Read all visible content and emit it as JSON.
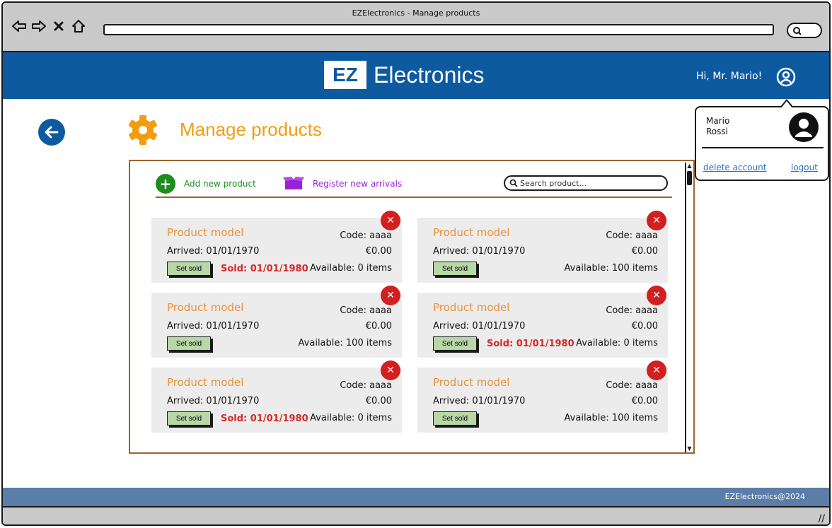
{
  "window": {
    "title": "EZElectronics - Manage products"
  },
  "browser": {
    "icons": [
      "back-arrow-icon",
      "forward-arrow-icon",
      "close-x-icon",
      "home-icon"
    ],
    "url": ""
  },
  "header": {
    "logo_box": "EZ",
    "logo_text": "Electronics",
    "greeting": "Hi, Mr. Mario!",
    "user_icon": "user-circle-icon",
    "color": "#0e5aa0"
  },
  "page": {
    "title": "Manage products",
    "title_color": "#f39c12",
    "icon": "gear-icon",
    "back_icon": "back-arrow-icon"
  },
  "toolbar": {
    "add_label": "Add new product",
    "register_label": "Register new arrivals",
    "search_placeholder": "Search product..."
  },
  "products": [
    {
      "model": "Product model",
      "code": "Code: aaaa",
      "arrived": "Arrived: 01/01/1970",
      "price": "€0.00",
      "set_sold": "Set sold",
      "sold": "Sold: 01/01/1980",
      "available": "Available: 0 items"
    },
    {
      "model": "Product model",
      "code": "Code: aaaa",
      "arrived": "Arrived: 01/01/1970",
      "price": "€0.00",
      "set_sold": "Set sold",
      "sold": "",
      "available": "Available: 100 items"
    },
    {
      "model": "Product model",
      "code": "Code: aaaa",
      "arrived": "Arrived: 01/01/1970",
      "price": "€0.00",
      "set_sold": "Set sold",
      "sold": "",
      "available": "Available: 100 items"
    },
    {
      "model": "Product model",
      "code": "Code: aaaa",
      "arrived": "Arrived: 01/01/1970",
      "price": "€0.00",
      "set_sold": "Set sold",
      "sold": "Sold: 01/01/1980",
      "available": "Available: 0 items"
    },
    {
      "model": "Product model",
      "code": "Code: aaaa",
      "arrived": "Arrived: 01/01/1970",
      "price": "€0.00",
      "set_sold": "Set sold",
      "sold": "Sold: 01/01/1980",
      "available": "Available: 0 items"
    },
    {
      "model": "Product model",
      "code": "Code: aaaa",
      "arrived": "Arrived: 01/01/1970",
      "price": "€0.00",
      "set_sold": "Set sold",
      "sold": "",
      "available": "Available: 100 items"
    }
  ],
  "user_popup": {
    "first_name": "Mario",
    "last_name": "Rossi",
    "delete_account": "delete account",
    "logout": "logout"
  },
  "footer": {
    "text": "EZElectronics@2024"
  },
  "colors": {
    "accent": "#f39c12",
    "danger": "#d21f1f",
    "success": "#1c8c1c",
    "purple": "#9b20d9",
    "footer": "#5b7ea8"
  }
}
